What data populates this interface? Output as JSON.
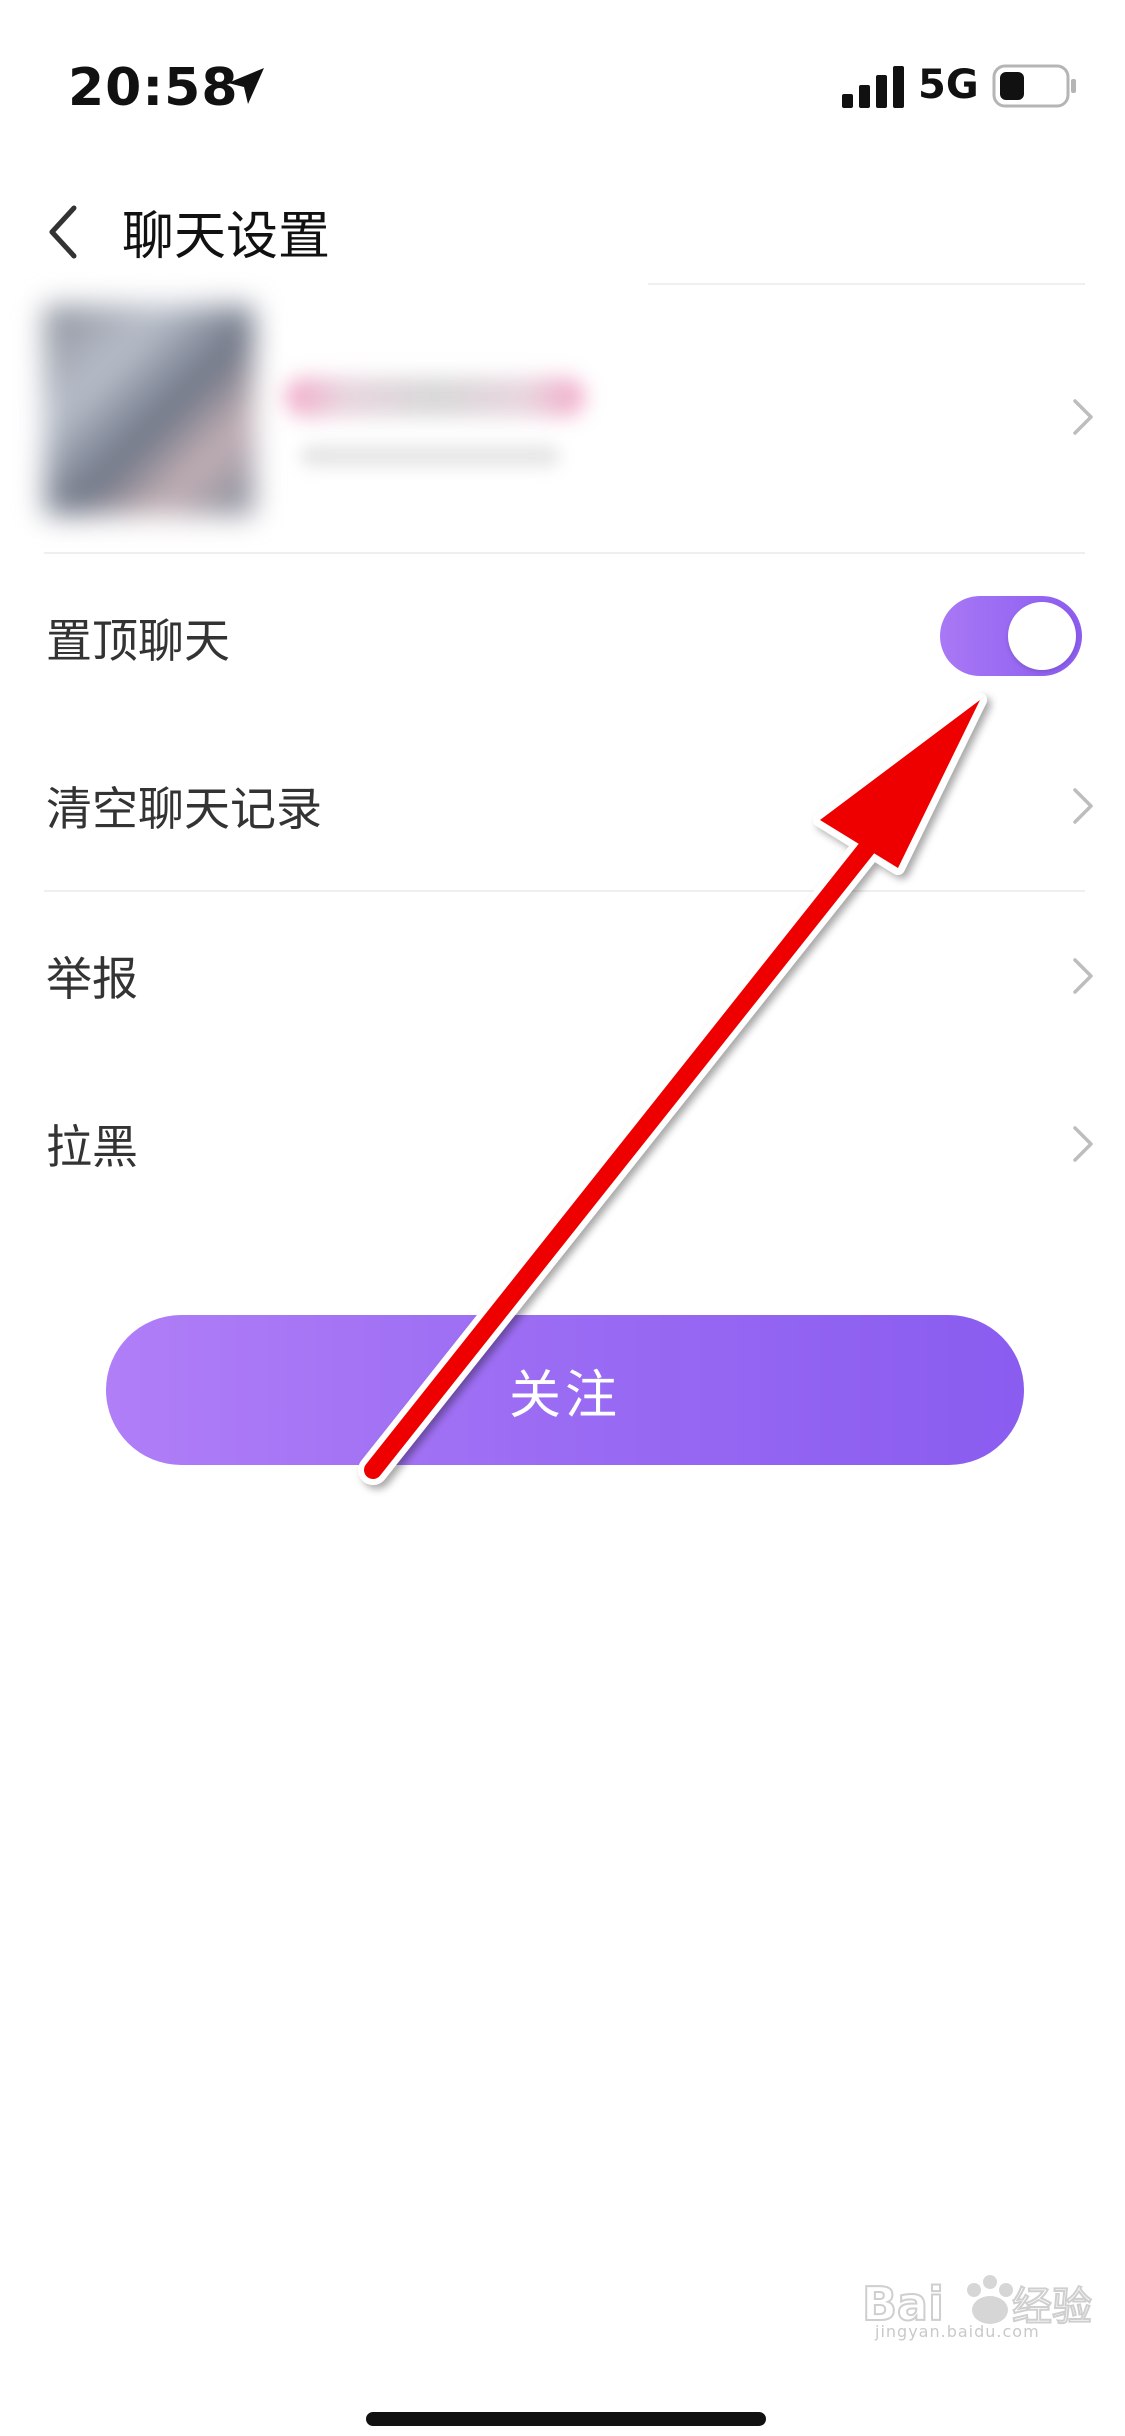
{
  "status_bar": {
    "time": "20:58",
    "network": "5G",
    "icons": [
      "location-arrow-icon",
      "signal-bars-icon",
      "battery-icon"
    ]
  },
  "nav": {
    "title": "聊天设置",
    "back_icon": "chevron-left-icon"
  },
  "settings": [
    {
      "label": "置顶聊天",
      "control": "toggle",
      "on": true
    },
    {
      "label": "清空聊天记录",
      "control": "chevron"
    },
    {
      "label": "举报",
      "control": "chevron"
    },
    {
      "label": "拉黑",
      "control": "chevron"
    }
  ],
  "follow_button": {
    "label": "关注"
  },
  "watermark": {
    "text": "jingyan.baidu.com"
  },
  "colors": {
    "accent": "#9b6cf3",
    "accent_light": "#b07ef7",
    "annotation": "#ff0000"
  }
}
